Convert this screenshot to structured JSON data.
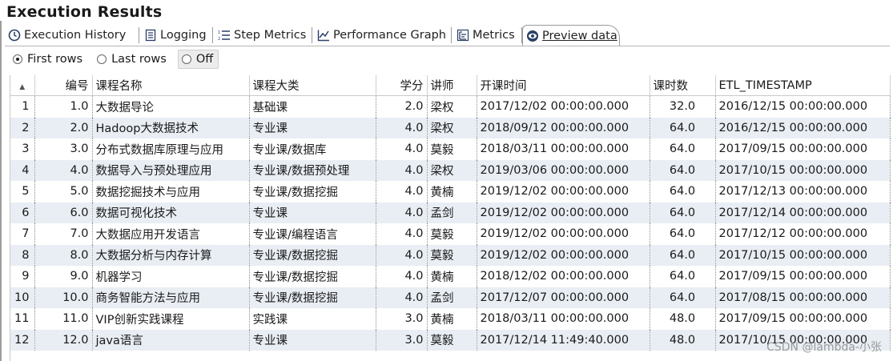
{
  "header": {
    "title": "Execution Results"
  },
  "tabs": [
    {
      "label": "Execution History",
      "icon": "clock-icon",
      "active": false
    },
    {
      "label": "Logging",
      "icon": "document-icon",
      "active": false
    },
    {
      "label": "Step Metrics",
      "icon": "numbered-list-icon",
      "active": false
    },
    {
      "label": "Performance Graph",
      "icon": "line-chart-icon",
      "active": false
    },
    {
      "label": "Metrics",
      "icon": "tree-metrics-icon",
      "active": false
    },
    {
      "label": "Preview data",
      "icon": "eye-icon",
      "active": true
    }
  ],
  "preview_mode": {
    "options": [
      {
        "label": "First rows",
        "selected": true
      },
      {
        "label": "Last rows",
        "selected": false
      },
      {
        "label": "Off",
        "selected": false
      }
    ]
  },
  "grid": {
    "sort_indicator": "▲",
    "columns": [
      "编号",
      "课程名称",
      "课程大类",
      "学分",
      "讲师",
      "开课时间",
      "课时数",
      "ETL_TIMESTAMP"
    ],
    "rows": [
      [
        "1",
        "1.0",
        "大数据导论",
        "基础课",
        "2.0",
        "梁权",
        "2017/12/02 00:00:00.000",
        "32.0",
        "2016/12/15 00:00:00.000"
      ],
      [
        "2",
        "2.0",
        "Hadoop大数据技术",
        "专业课",
        "4.0",
        "梁权",
        "2018/09/12 00:00:00.000",
        "64.0",
        "2016/12/15 00:00:00.000"
      ],
      [
        "3",
        "3.0",
        "分布式数据库原理与应用",
        "专业课/数据库",
        "4.0",
        "莫毅",
        "2018/03/11 00:00:00.000",
        "64.0",
        "2017/09/15 00:00:00.000"
      ],
      [
        "4",
        "4.0",
        "数据导入与预处理应用",
        "专业课/数据预处理",
        "4.0",
        "梁权",
        "2019/03/06 00:00:00.000",
        "64.0",
        "2017/10/15 00:00:00.000"
      ],
      [
        "5",
        "5.0",
        "数据挖掘技术与应用",
        "专业课/数据挖掘",
        "4.0",
        "黄楠",
        "2019/12/02 00:00:00.000",
        "64.0",
        "2017/12/13 00:00:00.000"
      ],
      [
        "6",
        "6.0",
        "数据可视化技术",
        "专业课",
        "4.0",
        "孟剑",
        "2019/12/02 00:00:00.000",
        "64.0",
        "2017/12/14 00:00:00.000"
      ],
      [
        "7",
        "7.0",
        "大数据应用开发语言",
        "专业课/编程语言",
        "4.0",
        "莫毅",
        "2019/12/02 00:00:00.000",
        "64.0",
        "2017/12/12 00:00:00.000"
      ],
      [
        "8",
        "8.0",
        "大数据分析与内存计算",
        "专业课/数据挖掘",
        "4.0",
        "莫毅",
        "2019/12/02 00:00:00.000",
        "64.0",
        "2017/10/15 00:00:00.000"
      ],
      [
        "9",
        "9.0",
        "机器学习",
        "专业课/数据挖掘",
        "4.0",
        "黄楠",
        "2018/12/02 00:00:00.000",
        "64.0",
        "2017/09/15 00:00:00.000"
      ],
      [
        "10",
        "10.0",
        "商务智能方法与应用",
        "专业课/数据挖掘",
        "4.0",
        "孟剑",
        "2017/12/07 00:00:00.000",
        "64.0",
        "2017/08/15 00:00:00.000"
      ],
      [
        "11",
        "11.0",
        "VIP创新实践课程",
        "实践课",
        "3.0",
        "黄楠",
        "2018/03/11 00:00:00.000",
        "48.0",
        "2017/09/15 00:00:00.000"
      ],
      [
        "12",
        "12.0",
        "java语言",
        "专业课",
        "3.0",
        "莫毅",
        "2017/12/14 11:49:40.000",
        "48.0",
        "2017/10/15 00:00:00.000"
      ]
    ]
  },
  "watermark": "CSDN @lambda-小张"
}
